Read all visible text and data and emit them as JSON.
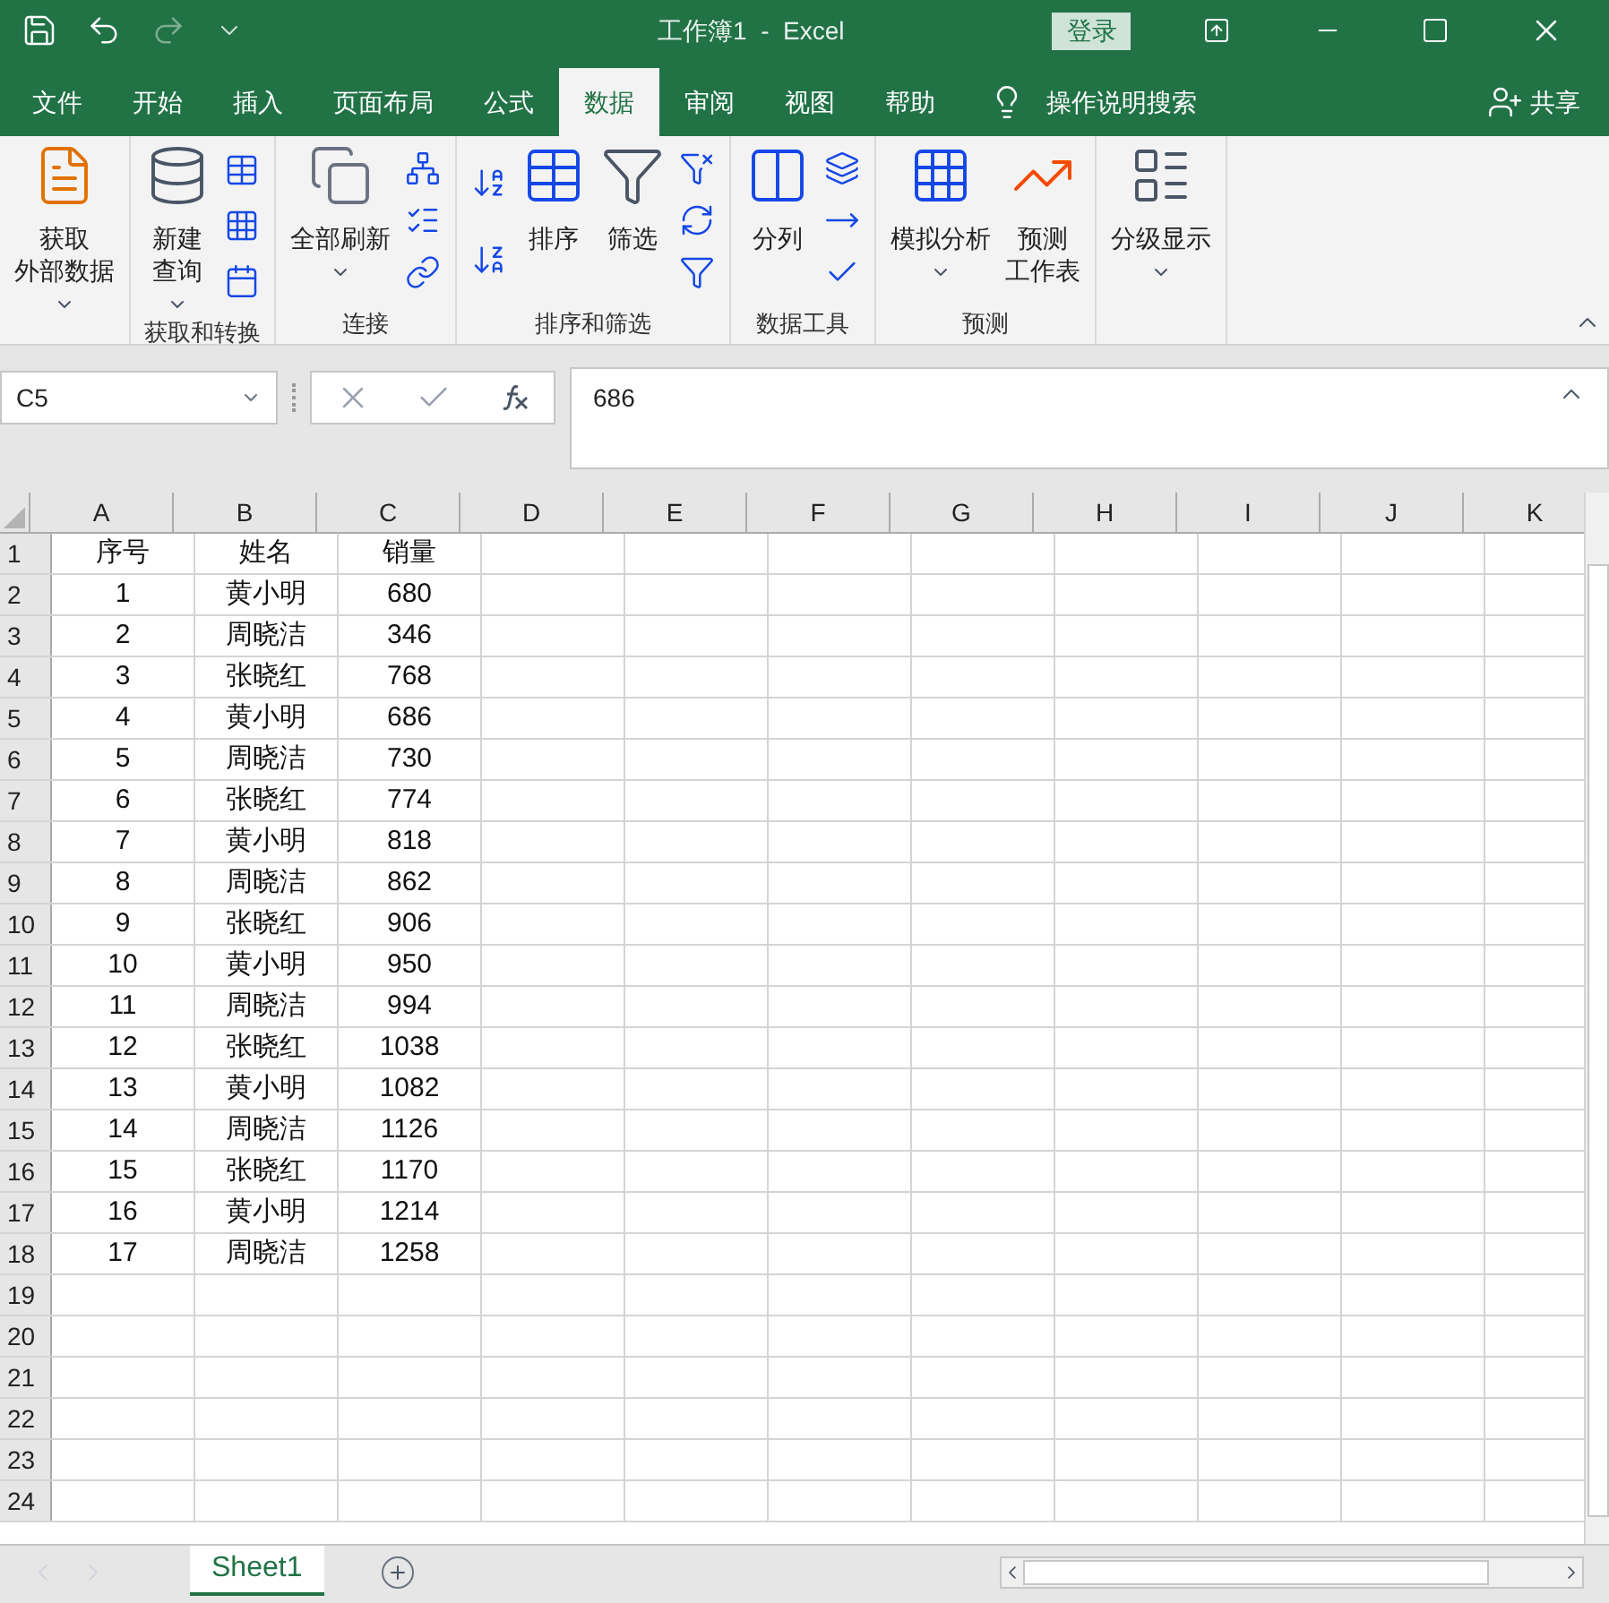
{
  "window": {
    "title": "工作簿1  -  Excel",
    "sign_in": "登录"
  },
  "tabs": [
    {
      "label": "文件",
      "selected": false
    },
    {
      "label": "开始",
      "selected": false
    },
    {
      "label": "插入",
      "selected": false
    },
    {
      "label": "页面布局",
      "selected": false
    },
    {
      "label": "公式",
      "selected": false
    },
    {
      "label": "数据",
      "selected": true
    },
    {
      "label": "审阅",
      "selected": false
    },
    {
      "label": "视图",
      "selected": false
    },
    {
      "label": "帮助",
      "selected": false
    }
  ],
  "tell_me": "操作说明搜索",
  "share": "共享",
  "ribbon": [
    {
      "buttons": [
        {
          "lines": [
            "获取",
            "外部数据"
          ],
          "dropdown": true
        }
      ]
    },
    {
      "label": "获取和转换",
      "buttons": [
        {
          "lines": [
            "新建",
            "查询"
          ],
          "dropdown": true
        }
      ]
    },
    {
      "label": "连接",
      "buttons": [
        {
          "lines": [
            "全部刷新"
          ],
          "dropdown": true
        }
      ]
    },
    {
      "label": "排序和筛选",
      "buttons": [
        {
          "lines": [
            "排序"
          ],
          "dropdown": false
        },
        {
          "lines": [
            "筛选"
          ],
          "dropdown": false
        }
      ]
    },
    {
      "label": "数据工具",
      "buttons": [
        {
          "lines": [
            "分列"
          ],
          "dropdown": false
        }
      ]
    },
    {
      "label": "预测",
      "buttons": [
        {
          "lines": [
            "模拟分析"
          ],
          "dropdown": true
        },
        {
          "lines": [
            "预测",
            "工作表"
          ],
          "dropdown": false
        }
      ]
    },
    {
      "buttons": [
        {
          "lines": [
            "分级显示"
          ],
          "dropdown": true
        }
      ]
    }
  ],
  "name_box": "C5",
  "formula": "686",
  "columns": [
    "A",
    "B",
    "C",
    "D",
    "E",
    "F",
    "G",
    "H",
    "I",
    "J",
    "K"
  ],
  "rows": [
    {
      "num": "1",
      "cells": [
        "序号",
        "姓名",
        "销量"
      ]
    },
    {
      "num": "2",
      "cells": [
        "1",
        "黄小明",
        "680"
      ]
    },
    {
      "num": "3",
      "cells": [
        "2",
        "周晓洁",
        "346"
      ]
    },
    {
      "num": "4",
      "cells": [
        "3",
        "张晓红",
        "768"
      ]
    },
    {
      "num": "5",
      "cells": [
        "4",
        "黄小明",
        "686"
      ]
    },
    {
      "num": "6",
      "cells": [
        "5",
        "周晓洁",
        "730"
      ]
    },
    {
      "num": "7",
      "cells": [
        "6",
        "张晓红",
        "774"
      ]
    },
    {
      "num": "8",
      "cells": [
        "7",
        "黄小明",
        "818"
      ]
    },
    {
      "num": "9",
      "cells": [
        "8",
        "周晓洁",
        "862"
      ]
    },
    {
      "num": "10",
      "cells": [
        "9",
        "张晓红",
        "906"
      ]
    },
    {
      "num": "11",
      "cells": [
        "10",
        "黄小明",
        "950"
      ]
    },
    {
      "num": "12",
      "cells": [
        "11",
        "周晓洁",
        "994"
      ]
    },
    {
      "num": "13",
      "cells": [
        "12",
        "张晓红",
        "1038"
      ]
    },
    {
      "num": "14",
      "cells": [
        "13",
        "黄小明",
        "1082"
      ]
    },
    {
      "num": "15",
      "cells": [
        "14",
        "周晓洁",
        "1126"
      ]
    },
    {
      "num": "16",
      "cells": [
        "15",
        "张晓红",
        "1170"
      ]
    },
    {
      "num": "17",
      "cells": [
        "16",
        "黄小明",
        "1214"
      ]
    },
    {
      "num": "18",
      "cells": [
        "17",
        "周晓洁",
        "1258"
      ]
    },
    {
      "num": "19",
      "cells": []
    },
    {
      "num": "20",
      "cells": []
    },
    {
      "num": "21",
      "cells": []
    },
    {
      "num": "22",
      "cells": []
    },
    {
      "num": "23",
      "cells": []
    },
    {
      "num": "24",
      "cells": []
    }
  ],
  "sheets": [
    {
      "label": "Sheet1",
      "selected": true
    }
  ]
}
